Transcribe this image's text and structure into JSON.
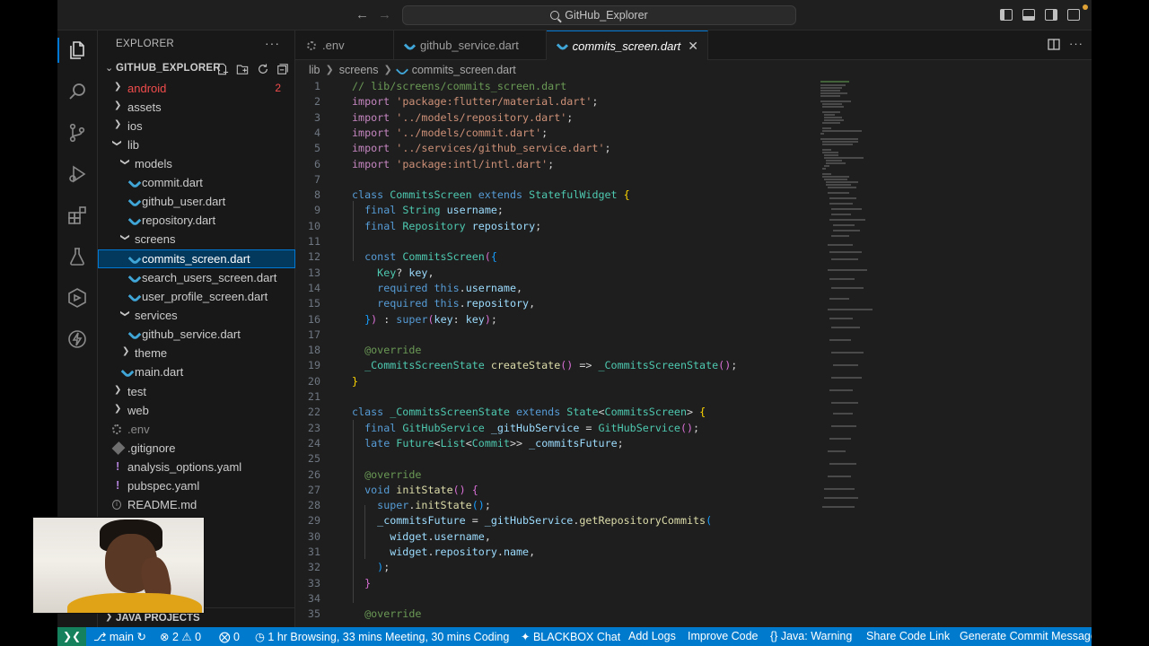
{
  "titlebar": {
    "search_text": "GitHub_Explorer",
    "back_icon": "arrow-left-icon",
    "forward_icon": "arrow-right-icon"
  },
  "activity_bar": {
    "items": [
      "explorer-icon",
      "search-icon",
      "source-control-icon",
      "run-debug-icon",
      "extensions-icon",
      "testing-icon",
      "remote-explorer-icon",
      "lightning-icon"
    ]
  },
  "sidebar": {
    "title": "EXPLORER",
    "more": "···",
    "root": "GITHUB_EXPLORER",
    "tree": [
      {
        "label": "android",
        "badge": "2"
      },
      {
        "label": "assets"
      },
      {
        "label": "ios"
      },
      {
        "label": "lib"
      },
      {
        "label": "models"
      },
      {
        "label": "commit.dart"
      },
      {
        "label": "github_user.dart"
      },
      {
        "label": "repository.dart"
      },
      {
        "label": "screens"
      },
      {
        "label": "commits_screen.dart"
      },
      {
        "label": "search_users_screen.dart"
      },
      {
        "label": "user_profile_screen.dart"
      },
      {
        "label": "services"
      },
      {
        "label": "github_service.dart"
      },
      {
        "label": "theme"
      },
      {
        "label": "main.dart"
      },
      {
        "label": "test"
      },
      {
        "label": "web"
      },
      {
        "label": ".env"
      },
      {
        "label": ".gitignore"
      },
      {
        "label": "analysis_options.yaml"
      },
      {
        "label": "pubspec.yaml"
      },
      {
        "label": "README.md"
      }
    ],
    "java_projects": "JAVA PROJECTS"
  },
  "tabs": [
    {
      "label": ".env"
    },
    {
      "label": "github_service.dart"
    },
    {
      "label": "commits_screen.dart",
      "close": "✕"
    }
  ],
  "breadcrumb": [
    "lib",
    "screens",
    "commits_screen.dart"
  ],
  "editor": {
    "line_numbers": [
      "1",
      "2",
      "3",
      "4",
      "5",
      "6",
      "7",
      "8",
      "9",
      "10",
      "11",
      "12",
      "13",
      "14",
      "15",
      "16",
      "17",
      "18",
      "19",
      "20",
      "21",
      "22",
      "23",
      "24",
      "25",
      "26",
      "27",
      "28",
      "29",
      "30",
      "31",
      "32",
      "33",
      "34",
      "35"
    ]
  },
  "statusbar": {
    "branch": "main",
    "errors": "2",
    "warnings": "0",
    "ports": "0",
    "activity": "1 hr Browsing, 33 mins Meeting, 30 mins Coding",
    "blackbox": "BLACKBOX Chat",
    "add_logs": "Add Logs",
    "improve_code": "Improve Code",
    "java": "Java: Warning",
    "share": "Share Code Link",
    "generate": "Generate Commit Message"
  },
  "colors": {
    "accent": "#0078d4",
    "statusbar": "#007acc",
    "error_badge": "#f14c4c"
  }
}
